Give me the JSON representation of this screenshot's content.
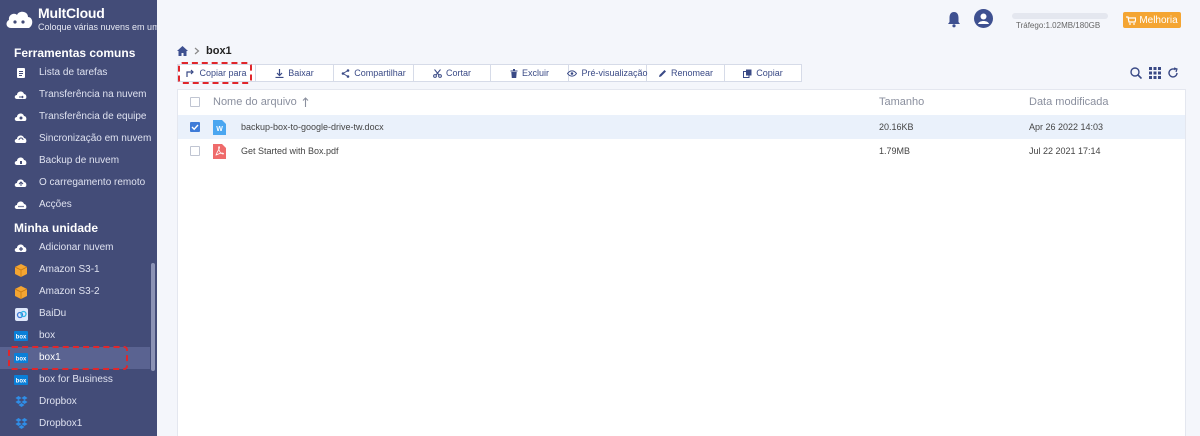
{
  "app": {
    "logo_name": "MultCloud",
    "logo_tagline": "Coloque várias nuvens em uma"
  },
  "sidebar": {
    "section_tools": "Ferramentas comuns",
    "tools": [
      {
        "label": "Lista de tarefas",
        "icon": "task-list-icon"
      },
      {
        "label": "Transferência na nuvem",
        "icon": "cloud-transfer-icon"
      },
      {
        "label": "Transferência de equipe",
        "icon": "team-transfer-icon"
      },
      {
        "label": "Sincronização em nuvem",
        "icon": "cloud-sync-icon"
      },
      {
        "label": "Backup de nuvem",
        "icon": "cloud-backup-icon"
      },
      {
        "label": "O carregamento remoto",
        "icon": "remote-upload-icon"
      },
      {
        "label": "Acções",
        "icon": "actions-icon"
      }
    ],
    "section_drive": "Minha unidade",
    "drives": [
      {
        "label": "Adicionar nuvem",
        "icon": "add-cloud-icon"
      },
      {
        "label": "Amazon S3-1",
        "icon": "amazon-s3-icon"
      },
      {
        "label": "Amazon S3-2",
        "icon": "amazon-s3-icon"
      },
      {
        "label": "BaiDu",
        "icon": "baidu-icon"
      },
      {
        "label": "box",
        "icon": "box-icon"
      },
      {
        "label": "box1",
        "icon": "box-icon"
      },
      {
        "label": "box for Business",
        "icon": "box-icon"
      },
      {
        "label": "Dropbox",
        "icon": "dropbox-icon"
      },
      {
        "label": "Dropbox1",
        "icon": "dropbox-icon"
      }
    ],
    "active_drive": "box1"
  },
  "topbar": {
    "traffic_text": "Tráfego:1.02MB/180GB",
    "traffic_fraction": 5.7e-06,
    "upgrade_label": "Melhoria"
  },
  "breadcrumb": {
    "current": "box1"
  },
  "toolbar": {
    "copy_to": "Copiar para",
    "download": "Baixar",
    "share": "Compartilhar",
    "cut": "Cortar",
    "delete": "Excluir",
    "preview": "Pré-visualização",
    "rename": "Renomear",
    "copy": "Copiar"
  },
  "list": {
    "col_name": "Nome do arquivo",
    "col_size": "Tamanho",
    "col_date": "Data modificada",
    "files": [
      {
        "name": "backup-box-to-google-drive-tw.docx",
        "size": "20.16KB",
        "date": "Apr 26 2022 14:03",
        "type": "docx",
        "checked": true
      },
      {
        "name": "Get Started with Box.pdf",
        "size": "1.79MB",
        "date": "Jul 22 2021 17:14",
        "type": "pdf",
        "checked": false
      }
    ]
  },
  "colors": {
    "sidebar_bg": "#434c78",
    "accent": "#3e7bd8",
    "upgrade": "#f4a532",
    "highlight": "#e0262b"
  }
}
